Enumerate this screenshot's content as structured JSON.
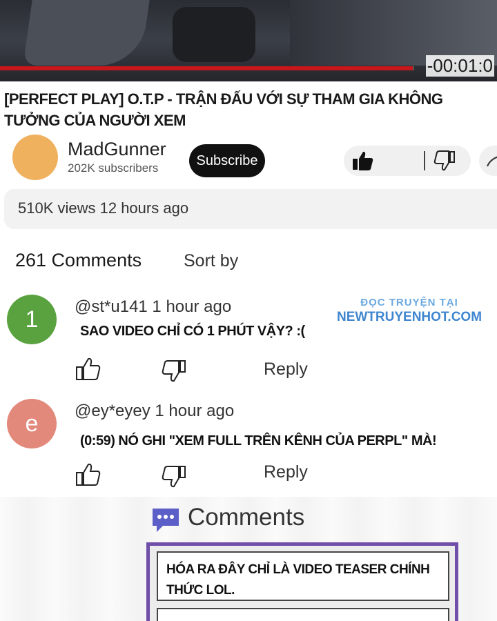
{
  "video": {
    "time": "-00:01:0",
    "progress": 0.83,
    "title": "[PERFECT PLAY] O.T.P - TRẬN ĐẤU VỚI SỰ THAM GIA KHÔNG TƯỞNG CỦA NGƯỜI XEM"
  },
  "channel": {
    "name": "MadGunner",
    "subscribers": "202K subscribers",
    "subscribe_label": "Subscribe",
    "avatar_color": "#f0b15e"
  },
  "stats": "510K views 12 hours ago",
  "comments_section": {
    "count": "261 Comments",
    "sort_label": "Sort by"
  },
  "watermark": {
    "line1": "ĐỌC TRUYỆN TẠI",
    "line2": "NEWTRUYENHOT.COM"
  },
  "comments": [
    {
      "avatar_letter": "1",
      "avatar_color": "#5aa23f",
      "meta": "@st*u141 1 hour ago",
      "text": "SAO VIDEO CHỈ CÓ 1 PHÚT VẬY? :(",
      "reply_label": "Reply"
    },
    {
      "avatar_letter": "e",
      "avatar_color": "#e3897c",
      "meta": "@ey*eyey 1 hour ago",
      "text": "(0:59) NÓ GHI \"XEM FULL TRÊN KÊNH CỦA PERPL\" MÀ!",
      "reply_label": "Reply"
    }
  ],
  "comments_panel": {
    "heading": "Comments",
    "first_comment": "HÓA RA ĐÂY CHỈ LÀ VIDEO TEASER CHÍNH THỨC LOL."
  },
  "icons": {
    "like": "thumbs-up-icon",
    "dislike": "thumbs-down-icon",
    "comments": "chat-bubble-icon",
    "share": "share-icon"
  },
  "colors": {
    "progress": "#c8161d",
    "panel_border": "#6f4fa8",
    "chat_icon": "#5b5fc7"
  }
}
